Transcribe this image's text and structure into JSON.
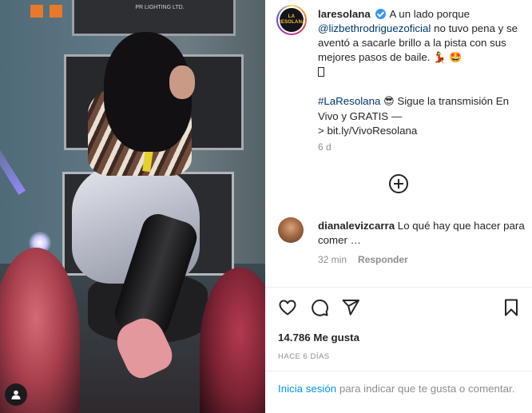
{
  "media": {
    "case_label": "PR LIGHTING LTD.",
    "profile_icon": "user-icon"
  },
  "post": {
    "avatar_label": "LA RESOLANA",
    "username": "laresolana",
    "caption": {
      "part1": "A un lado porque",
      "mention": "@lizbethrodriguezoficial",
      "part2": "no tuvo pena y se aventó a sacarle brillo a la pista con sus mejores pasos de baile.",
      "emoji1": "💃",
      "emoji2": "🤩",
      "hashtag": "#LaResolana",
      "emoji3": "😎",
      "part3": "Sigue la transmisión En Vivo y GRATIS —",
      "part4": "> bit.ly/VivoResolana"
    },
    "time_ago": "6 d",
    "load_more_icon": "plus-circle-icon"
  },
  "comment": {
    "username": "dianalevizcarra",
    "text": "Lo qué hay que hacer para comer …",
    "time_ago": "32 min",
    "reply_label": "Responder"
  },
  "actions": {
    "like_icon": "heart-icon",
    "comment_icon": "comment-icon",
    "share_icon": "share-icon",
    "save_icon": "bookmark-icon"
  },
  "likes": "14.786 Me gusta",
  "date": "HACE 6 DÍAS",
  "login": {
    "link": "Inicia sesión",
    "text": "para indicar que te gusta o comentar."
  },
  "colors": {
    "link_blue": "#0095f6",
    "mention_blue": "#00376b",
    "muted": "#8e8e8e",
    "text": "#262626"
  }
}
